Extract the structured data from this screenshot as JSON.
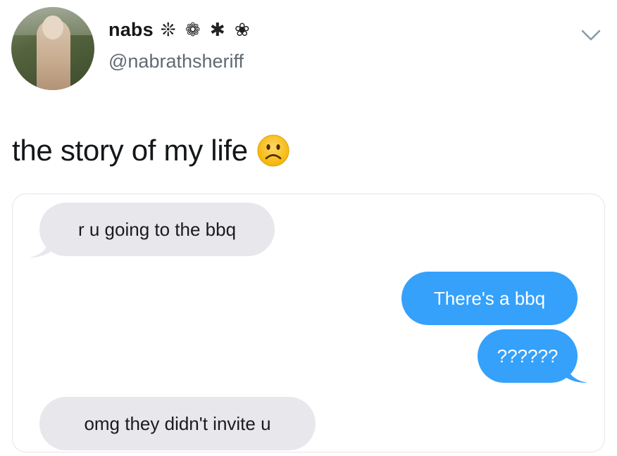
{
  "tweet": {
    "display_name": "nabs",
    "name_decorations": "❊ ❁ ✱ ❀",
    "handle": "@nabrathsheriff",
    "text": "the story of my life",
    "emoji": "frowning-face",
    "menu_icon": "chevron-down-icon"
  },
  "conversation": {
    "messages": [
      {
        "direction": "incoming",
        "text": "r u going to the bbq"
      },
      {
        "direction": "outgoing",
        "text": "There's a bbq"
      },
      {
        "direction": "outgoing",
        "text": "??????"
      },
      {
        "direction": "incoming",
        "text": "omg they didn't invite u"
      }
    ]
  },
  "colors": {
    "incoming_bubble": "#e7e7ec",
    "outgoing_bubble": "#35a1fb",
    "handle_text": "#606a73"
  }
}
